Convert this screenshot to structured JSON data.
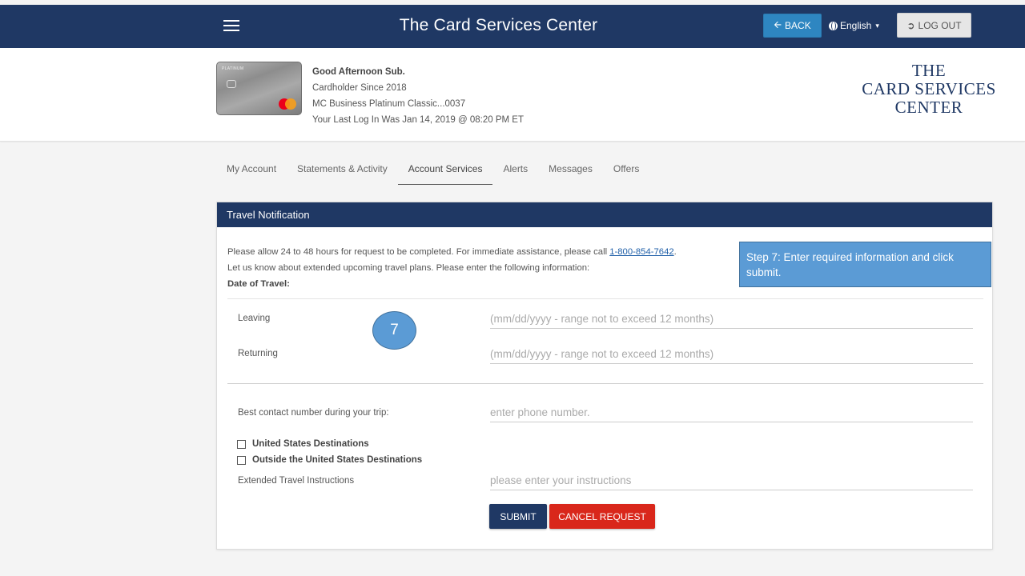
{
  "header": {
    "title": "The Card Services Center",
    "back_label": "BACK",
    "language": "English",
    "logout_label": "LOG OUT"
  },
  "profile": {
    "card_brand_text": "PLATINUM",
    "greeting": "Good Afternoon Sub.",
    "since": "Cardholder Since 2018",
    "account": "MC Business Platinum Classic...0037",
    "last_login": "Your Last Log In Was Jan 14, 2019 @ 08:20 PM ET",
    "logo_lines": [
      "THE",
      "CARD SERVICES",
      "CENTER"
    ]
  },
  "tabs": [
    {
      "label": "My Account"
    },
    {
      "label": "Statements & Activity"
    },
    {
      "label": "Account Services",
      "active": true
    },
    {
      "label": "Alerts"
    },
    {
      "label": "Messages"
    },
    {
      "label": "Offers"
    }
  ],
  "panel": {
    "title": "Travel Notification",
    "intro_line1": "Please allow 24 to 48 hours for request to be completed. For immediate assistance, please call ",
    "phone_link": "1-800-854-7642",
    "intro_period": ".",
    "intro_line2": "Let us know about extended upcoming travel plans. Please enter the following information:",
    "date_heading": "Date of Travel:",
    "callout": "Step 7: Enter required information and click submit.",
    "step_number": "7",
    "leaving_label": "Leaving",
    "leaving_placeholder": "(mm/dd/yyyy - range not to exceed 12 months)",
    "returning_label": "Returning",
    "returning_placeholder": "(mm/dd/yyyy - range not to exceed 12 months)",
    "contact_label": "Best contact number during your trip:",
    "contact_placeholder": "enter phone number.",
    "us_destinations": "United States Destinations",
    "outside_destinations": "Outside the United States Destinations",
    "instructions_label": "Extended Travel Instructions",
    "instructions_placeholder": "please enter your instructions",
    "submit_label": "SUBMIT",
    "cancel_label": "CANCEL REQUEST"
  },
  "colors": {
    "navy": "#1f3864",
    "back_blue": "#2e86c1",
    "callout_blue": "#5b9bd5",
    "cancel_red": "#d9271b"
  }
}
